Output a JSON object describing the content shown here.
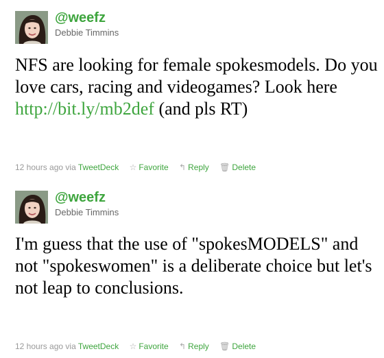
{
  "colors": {
    "link_green": "#3ea53e",
    "meta_gray": "#999999",
    "name_gray": "#666666"
  },
  "tweets": [
    {
      "screen_name": "@weefz",
      "full_name": "Debbie Timmins",
      "text_before_link": "NFS are looking for female spokesmodels. Do you love cars, racing and videogames? Look here ",
      "link": "http://bit.ly/mb2def",
      "text_after_link": " (and pls RT)",
      "timestamp": "12 hours ago",
      "via": "via",
      "source": "TweetDeck",
      "actions": {
        "favorite": "Favorite",
        "reply": "Reply",
        "delete": "Delete"
      },
      "icons": {
        "favorite": "star-icon",
        "reply": "reply-arrow-icon",
        "delete": "trash-icon"
      }
    },
    {
      "screen_name": "@weefz",
      "full_name": "Debbie Timmins",
      "text": "I'm guess that the use of \"spokesMODELS\" and not \"spokeswomen\" is a deliberate choice but let's not leap to conclusions.",
      "timestamp": "12 hours ago",
      "via": "via",
      "source": "TweetDeck",
      "actions": {
        "favorite": "Favorite",
        "reply": "Reply",
        "delete": "Delete"
      },
      "icons": {
        "favorite": "star-icon",
        "reply": "reply-arrow-icon",
        "delete": "trash-icon"
      }
    }
  ]
}
